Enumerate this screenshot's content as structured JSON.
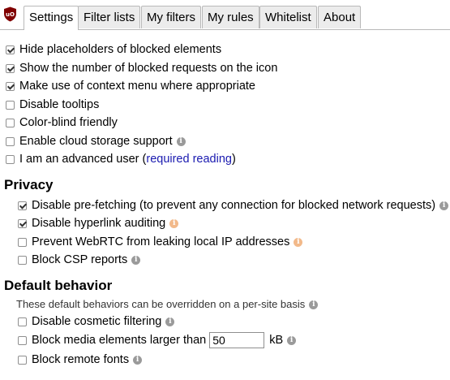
{
  "tabs": [
    {
      "label": "Settings"
    },
    {
      "label": "Filter lists"
    },
    {
      "label": "My filters"
    },
    {
      "label": "My rules"
    },
    {
      "label": "Whitelist"
    },
    {
      "label": "About"
    }
  ],
  "general": {
    "options": [
      {
        "label": "Hide placeholders of blocked elements",
        "checked": true
      },
      {
        "label": "Show the number of blocked requests on the icon",
        "checked": true
      },
      {
        "label": "Make use of context menu where appropriate",
        "checked": true
      },
      {
        "label": "Disable tooltips",
        "checked": false
      },
      {
        "label": "Color-blind friendly",
        "checked": false
      },
      {
        "label": "Enable cloud storage support",
        "checked": false
      },
      {
        "label": "I am an advanced user",
        "checked": false
      }
    ],
    "advanced_link_open": "(",
    "advanced_link": "required reading",
    "advanced_link_close": ")"
  },
  "privacy": {
    "heading": "Privacy",
    "options": [
      {
        "label": "Disable pre-fetching (to prevent any connection for blocked network requests)",
        "checked": true
      },
      {
        "label": "Disable hyperlink auditing",
        "checked": true
      },
      {
        "label": "Prevent WebRTC from leaking local IP addresses",
        "checked": false
      },
      {
        "label": "Block CSP reports",
        "checked": false
      }
    ]
  },
  "default_behavior": {
    "heading": "Default behavior",
    "note": "These default behaviors can be overridden on a per-site basis",
    "options": [
      {
        "label": "Disable cosmetic filtering",
        "checked": false
      },
      {
        "label": "Block media elements larger than",
        "checked": false,
        "value": "50",
        "unit": "kB"
      },
      {
        "label": "Block remote fonts",
        "checked": false
      }
    ]
  },
  "colors": {
    "link": "#1a1ab0",
    "logo": "#800000",
    "info_gray": "#9a9a9a",
    "info_orange": "#f2b98a"
  },
  "icons": {
    "logo": "ublock-logo-icon",
    "info": "info-icon"
  }
}
